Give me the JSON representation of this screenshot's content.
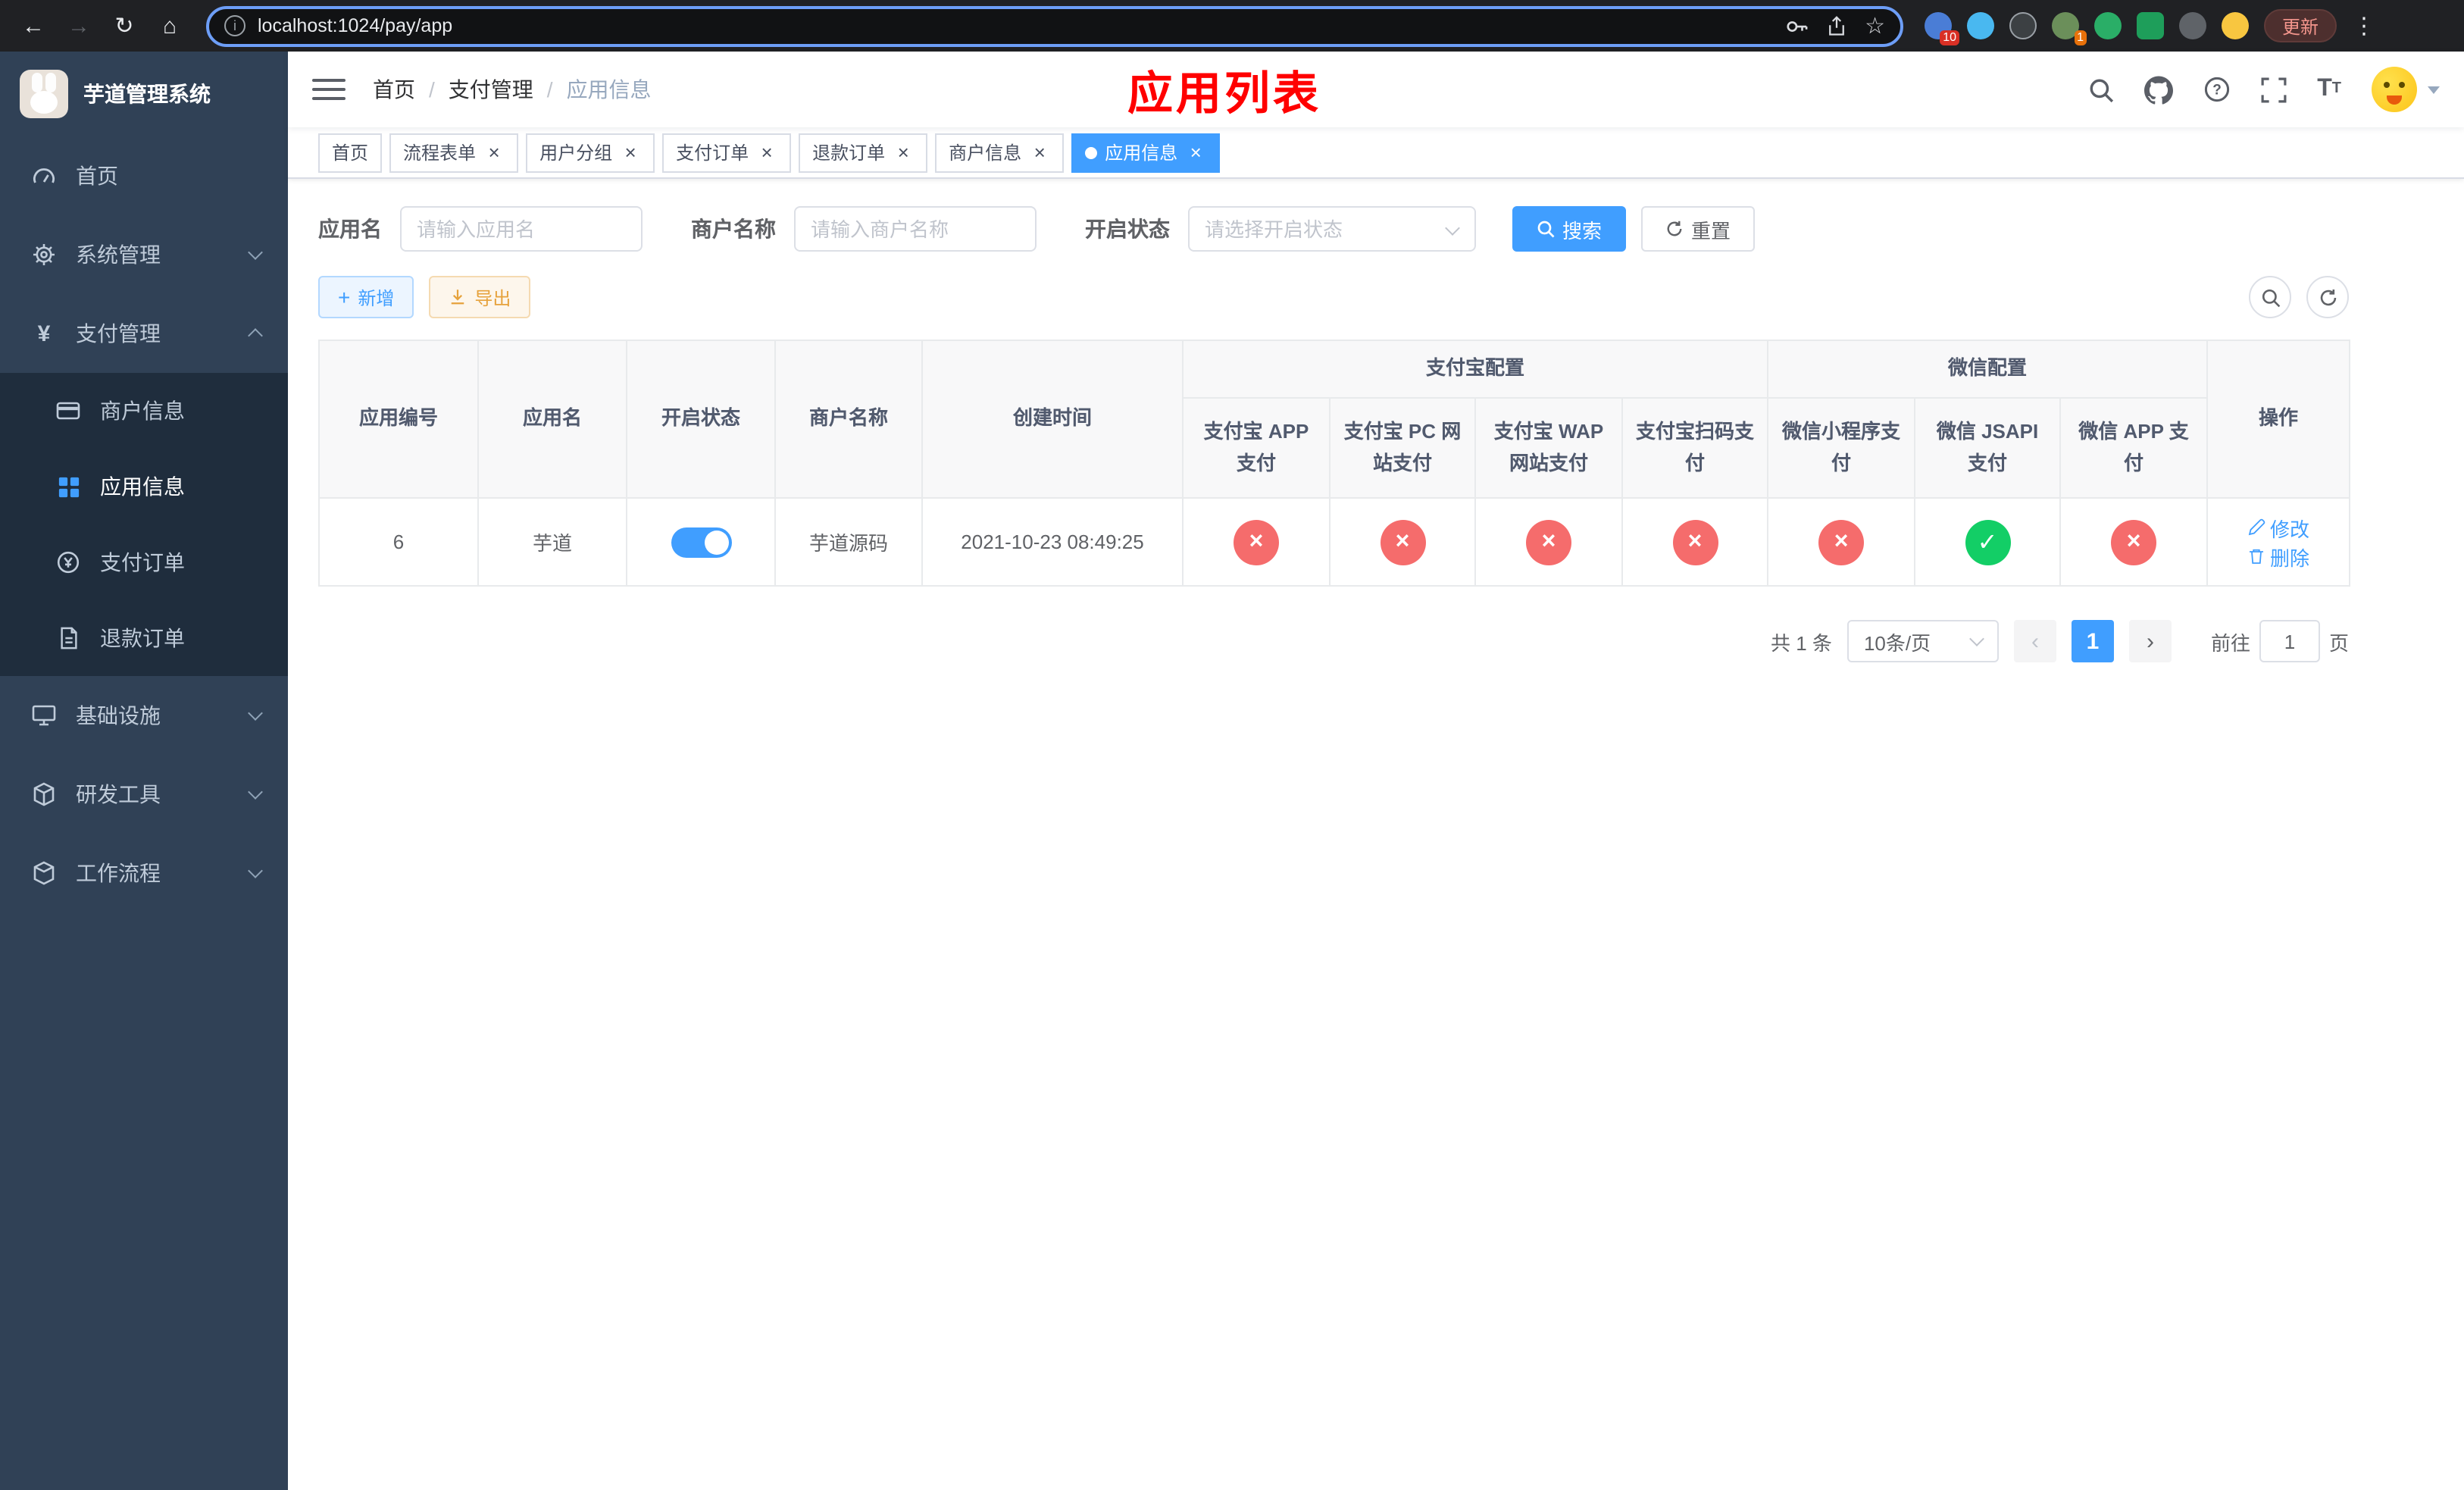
{
  "browser": {
    "url": "localhost:1024/pay/app",
    "update_label": "更新",
    "extension_badges": {
      "first": "10",
      "second": "1"
    },
    "icons": {
      "back": "←",
      "forward": "→",
      "reload": "↻",
      "home": "⌂",
      "star": "☆",
      "menu": "⋮"
    }
  },
  "sidebar": {
    "logo_title": "芋道管理系统",
    "items": [
      {
        "label": "首页"
      },
      {
        "label": "系统管理"
      },
      {
        "label": "支付管理"
      },
      {
        "label": "基础设施"
      },
      {
        "label": "研发工具"
      },
      {
        "label": "工作流程"
      }
    ],
    "payment_children": [
      {
        "label": "商户信息"
      },
      {
        "label": "应用信息"
      },
      {
        "label": "支付订单"
      },
      {
        "label": "退款订单"
      }
    ]
  },
  "header": {
    "breadcrumb": [
      "首页",
      "支付管理",
      "应用信息"
    ],
    "overlay_title": "应用列表"
  },
  "tabs": [
    {
      "label": "首页",
      "closable": false
    },
    {
      "label": "流程表单",
      "closable": true
    },
    {
      "label": "用户分组",
      "closable": true
    },
    {
      "label": "支付订单",
      "closable": true
    },
    {
      "label": "退款订单",
      "closable": true
    },
    {
      "label": "商户信息",
      "closable": true
    },
    {
      "label": "应用信息",
      "closable": true,
      "active": true
    }
  ],
  "filters": {
    "app_name_label": "应用名",
    "app_name_placeholder": "请输入应用名",
    "merchant_label": "商户名称",
    "merchant_placeholder": "请输入商户名称",
    "status_label": "开启状态",
    "status_placeholder": "请选择开启状态",
    "search_label": "搜索",
    "reset_label": "重置"
  },
  "toolbar": {
    "add_label": "新增",
    "export_label": "导出"
  },
  "table": {
    "groups": {
      "alipay": "支付宝配置",
      "wechat": "微信配置"
    },
    "columns": {
      "id": "应用编号",
      "name": "应用名",
      "status": "开启状态",
      "merchant": "商户名称",
      "created": "创建时间",
      "alipay_app": "支付宝 APP 支付",
      "alipay_pc": "支付宝 PC 网站支付",
      "alipay_wap": "支付宝 WAP 网站支付",
      "alipay_qr": "支付宝扫码支付",
      "wx_mini": "微信小程序支付",
      "wx_jsapi": "微信 JSAPI 支付",
      "wx_app": "微信 APP 支付",
      "actions": "操作"
    },
    "rows": [
      {
        "id": "6",
        "name": "芋道",
        "status_on": true,
        "merchant": "芋道源码",
        "created": "2021-10-23 08:49:25",
        "configs": {
          "alipay_app": false,
          "alipay_pc": false,
          "alipay_wap": false,
          "alipay_qr": false,
          "wx_mini": false,
          "wx_jsapi": true,
          "wx_app": false
        },
        "edit_label": "修改",
        "delete_label": "删除"
      }
    ]
  },
  "pagination": {
    "total_text": "共 1 条",
    "page_size": "10条/页",
    "current_page": "1",
    "goto_prefix": "前往",
    "goto_value": "1",
    "goto_suffix": "页"
  },
  "glyphs": {
    "close": "×",
    "check": "✓",
    "cross": "×",
    "prev": "‹",
    "next": "›",
    "plus": "+",
    "breadcrumb_sep": "/",
    "yen": "¥",
    "gear": "⚙"
  },
  "colors": {
    "primary": "#409eff",
    "success": "#13ce66",
    "danger": "#f56c6c",
    "warning": "#e6a23c",
    "sidebar_bg": "#304156",
    "submenu_bg": "#1f2d3d",
    "overlay_title": "#ff0000"
  }
}
